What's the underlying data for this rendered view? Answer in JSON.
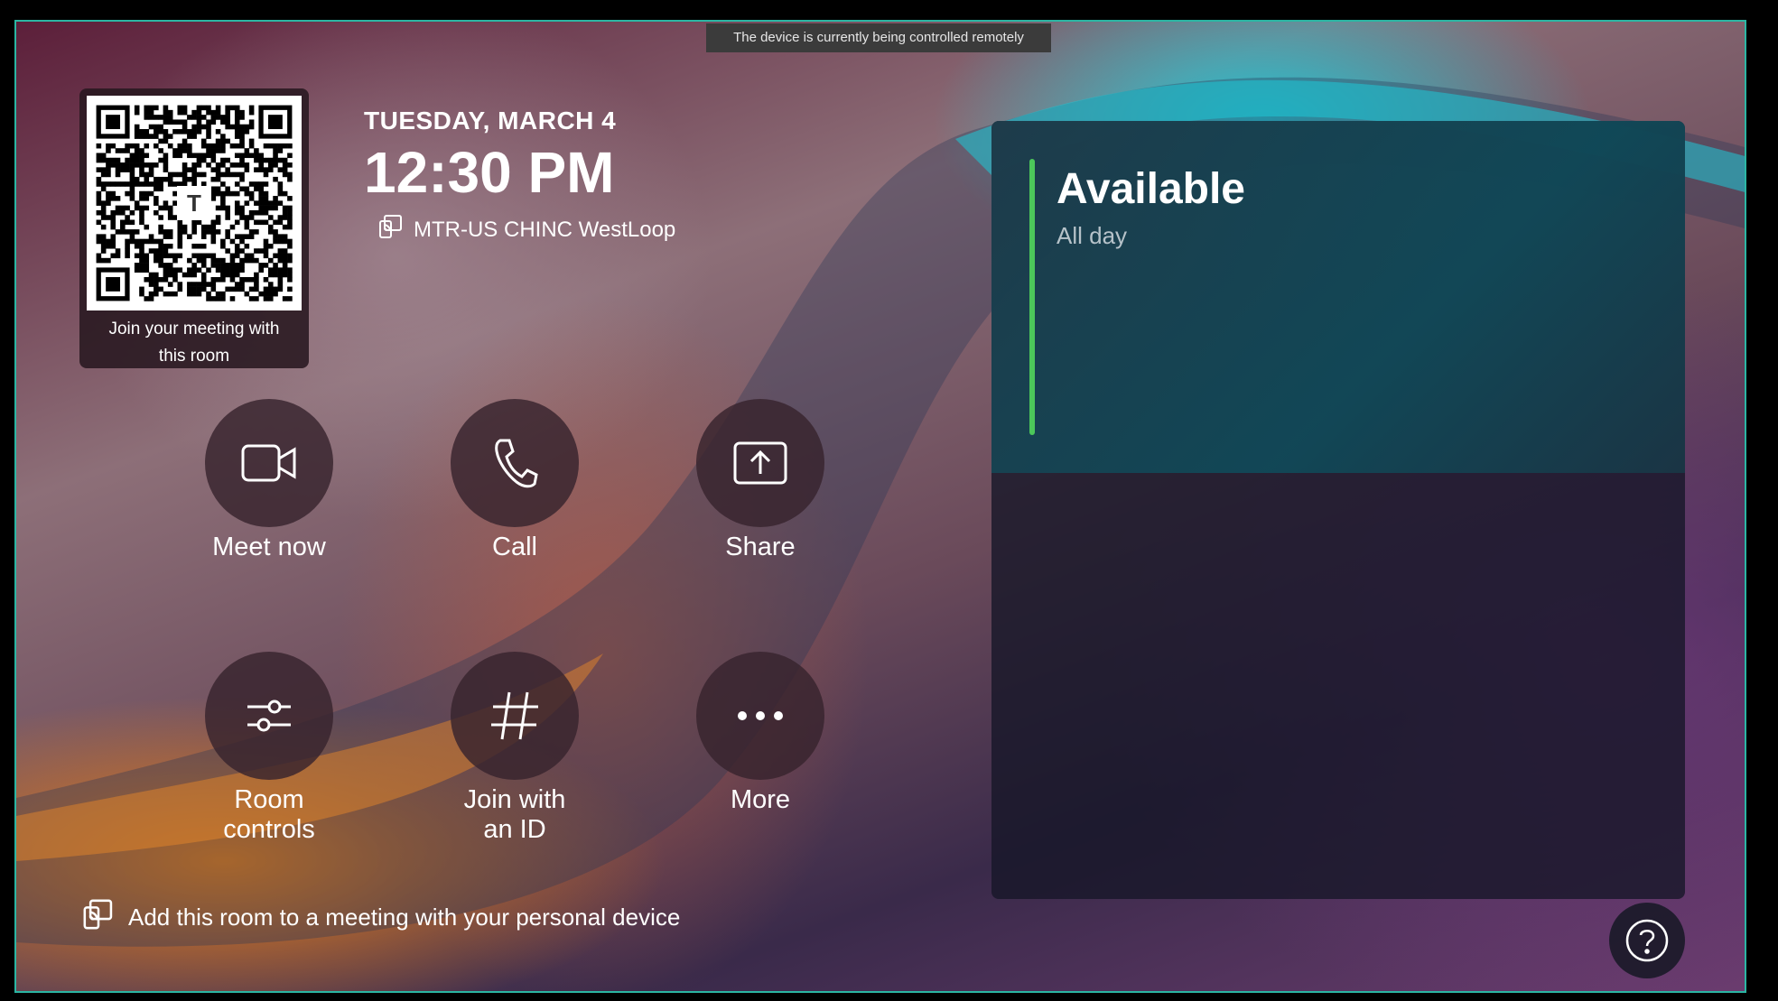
{
  "banner": {
    "text": "The device is currently being controlled remotely"
  },
  "qr": {
    "caption_line1": "Join your meeting with",
    "caption_line2": "this room",
    "logo_text": "T"
  },
  "header": {
    "date": "TUESDAY, MARCH 4",
    "time": "12:30 PM",
    "room_name": "MTR-US CHINC WestLoop",
    "room_icon": "cast-device-icon"
  },
  "actions": {
    "meet_now": {
      "label": "Meet now",
      "icon": "video-camera-icon"
    },
    "call": {
      "label": "Call",
      "icon": "phone-icon"
    },
    "share": {
      "label": "Share",
      "icon": "share-screen-icon"
    },
    "room_controls": {
      "line1": "Room",
      "line2": "controls",
      "icon": "sliders-icon"
    },
    "join_with_id": {
      "line1": "Join with",
      "line2": "an ID",
      "icon": "hash-icon"
    },
    "more": {
      "label": "More",
      "icon": "more-dots-icon"
    }
  },
  "footer": {
    "add_room": "Add this room to a meeting with your personal device",
    "icon": "cast-device-icon"
  },
  "calendar": {
    "status": "Available",
    "duration": "All day",
    "status_color": "#4cc75a"
  },
  "help": {
    "icon": "help-question-icon"
  },
  "colors": {
    "border": "#2bb6a3",
    "banner_bg": "#3b3b3b"
  }
}
